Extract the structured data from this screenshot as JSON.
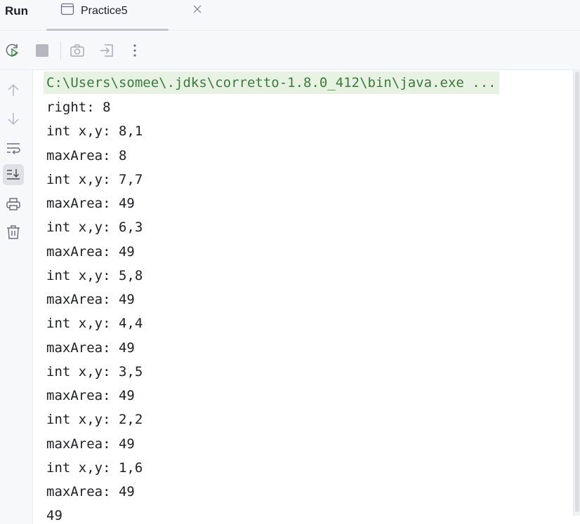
{
  "header": {
    "title": "Run",
    "tab_label": "Practice5"
  },
  "toolbar": {
    "buttons": [
      "rerun-icon",
      "stop-icon",
      "camera-icon",
      "exit-icon",
      "more-icon"
    ]
  },
  "gutter": {
    "buttons": [
      "arrow-up-icon",
      "arrow-down-icon",
      "soft-wrap-icon",
      "scroll-to-end-icon",
      "print-icon",
      "trash-icon"
    ]
  },
  "console": {
    "command": "C:\\Users\\somee\\.jdks\\corretto-1.8.0_412\\bin\\java.exe ...",
    "lines": [
      "right: 8",
      "int x,y: 8,1",
      "maxArea: 8",
      "int x,y: 7,7",
      "maxArea: 49",
      "int x,y: 6,3",
      "maxArea: 49",
      "int x,y: 5,8",
      "maxArea: 49",
      "int x,y: 4,4",
      "maxArea: 49",
      "int x,y: 3,5",
      "maxArea: 49",
      "int x,y: 2,2",
      "maxArea: 49",
      "int x,y: 1,6",
      "maxArea: 49",
      "49"
    ]
  },
  "colors": {
    "command_bg": "#e7f2e3",
    "command_fg": "#3a7a3a",
    "panel_bg": "#f7f8fa"
  }
}
